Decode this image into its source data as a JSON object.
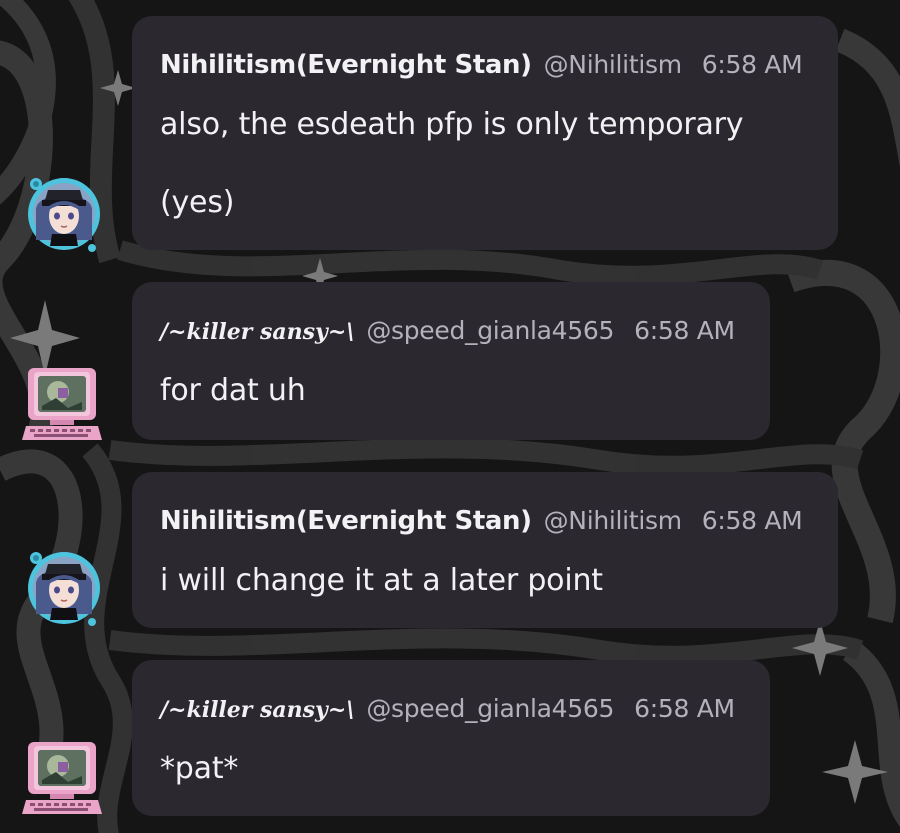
{
  "messages": [
    {
      "display_name": "Nihilitism(Evernight Stan)",
      "handle": "@Nihilitism",
      "time": "6:58 AM",
      "lines": [
        "also, the esdeath pfp is only temporary",
        "(yes)"
      ]
    },
    {
      "display_name": "/~killer sansy~\\",
      "handle": "@speed_gianla4565",
      "time": "6:58 AM",
      "lines": [
        "for dat uh"
      ]
    },
    {
      "display_name": "Nihilitism(Evernight Stan)",
      "handle": "@Nihilitism",
      "time": "6:58 AM",
      "lines": [
        "i will change it at a later point"
      ]
    },
    {
      "display_name": "/~killer sansy~\\",
      "handle": "@speed_gianla4565",
      "time": "6:58 AM",
      "lines": [
        "*pat*"
      ]
    }
  ],
  "avatars": {
    "nihilitism": "anime-character-avatar",
    "killer_sansy": "pink-computer-avatar"
  },
  "colors": {
    "bubble": "#2b2830",
    "background": "#131313",
    "name": "#f2f2f4",
    "meta": "#b3b1b9",
    "ring": "#4ec3dd",
    "computer": "#e9a4c8"
  }
}
